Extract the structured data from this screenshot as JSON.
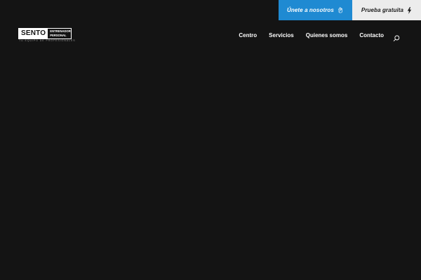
{
  "topbar": {
    "join_label": "Únete a nosotros",
    "join_icon": "hand-icon",
    "trial_label": "Prueba gratuita",
    "trial_icon": "lightning-icon"
  },
  "logo": {
    "mark": "SENTO",
    "sub_line1": "ENTRENADOR",
    "sub_line2": "PERSONAL",
    "tagline": "TU EQUIPO DE PROFESIONALES"
  },
  "nav": {
    "items": [
      "Centro",
      "Servicios",
      "Quienes somos",
      "Contacto"
    ],
    "search_icon": "search-icon"
  },
  "colors": {
    "background": "#141414",
    "join_button": "#1f8ad2",
    "trial_button": "#ececec",
    "text": "#ffffff"
  }
}
